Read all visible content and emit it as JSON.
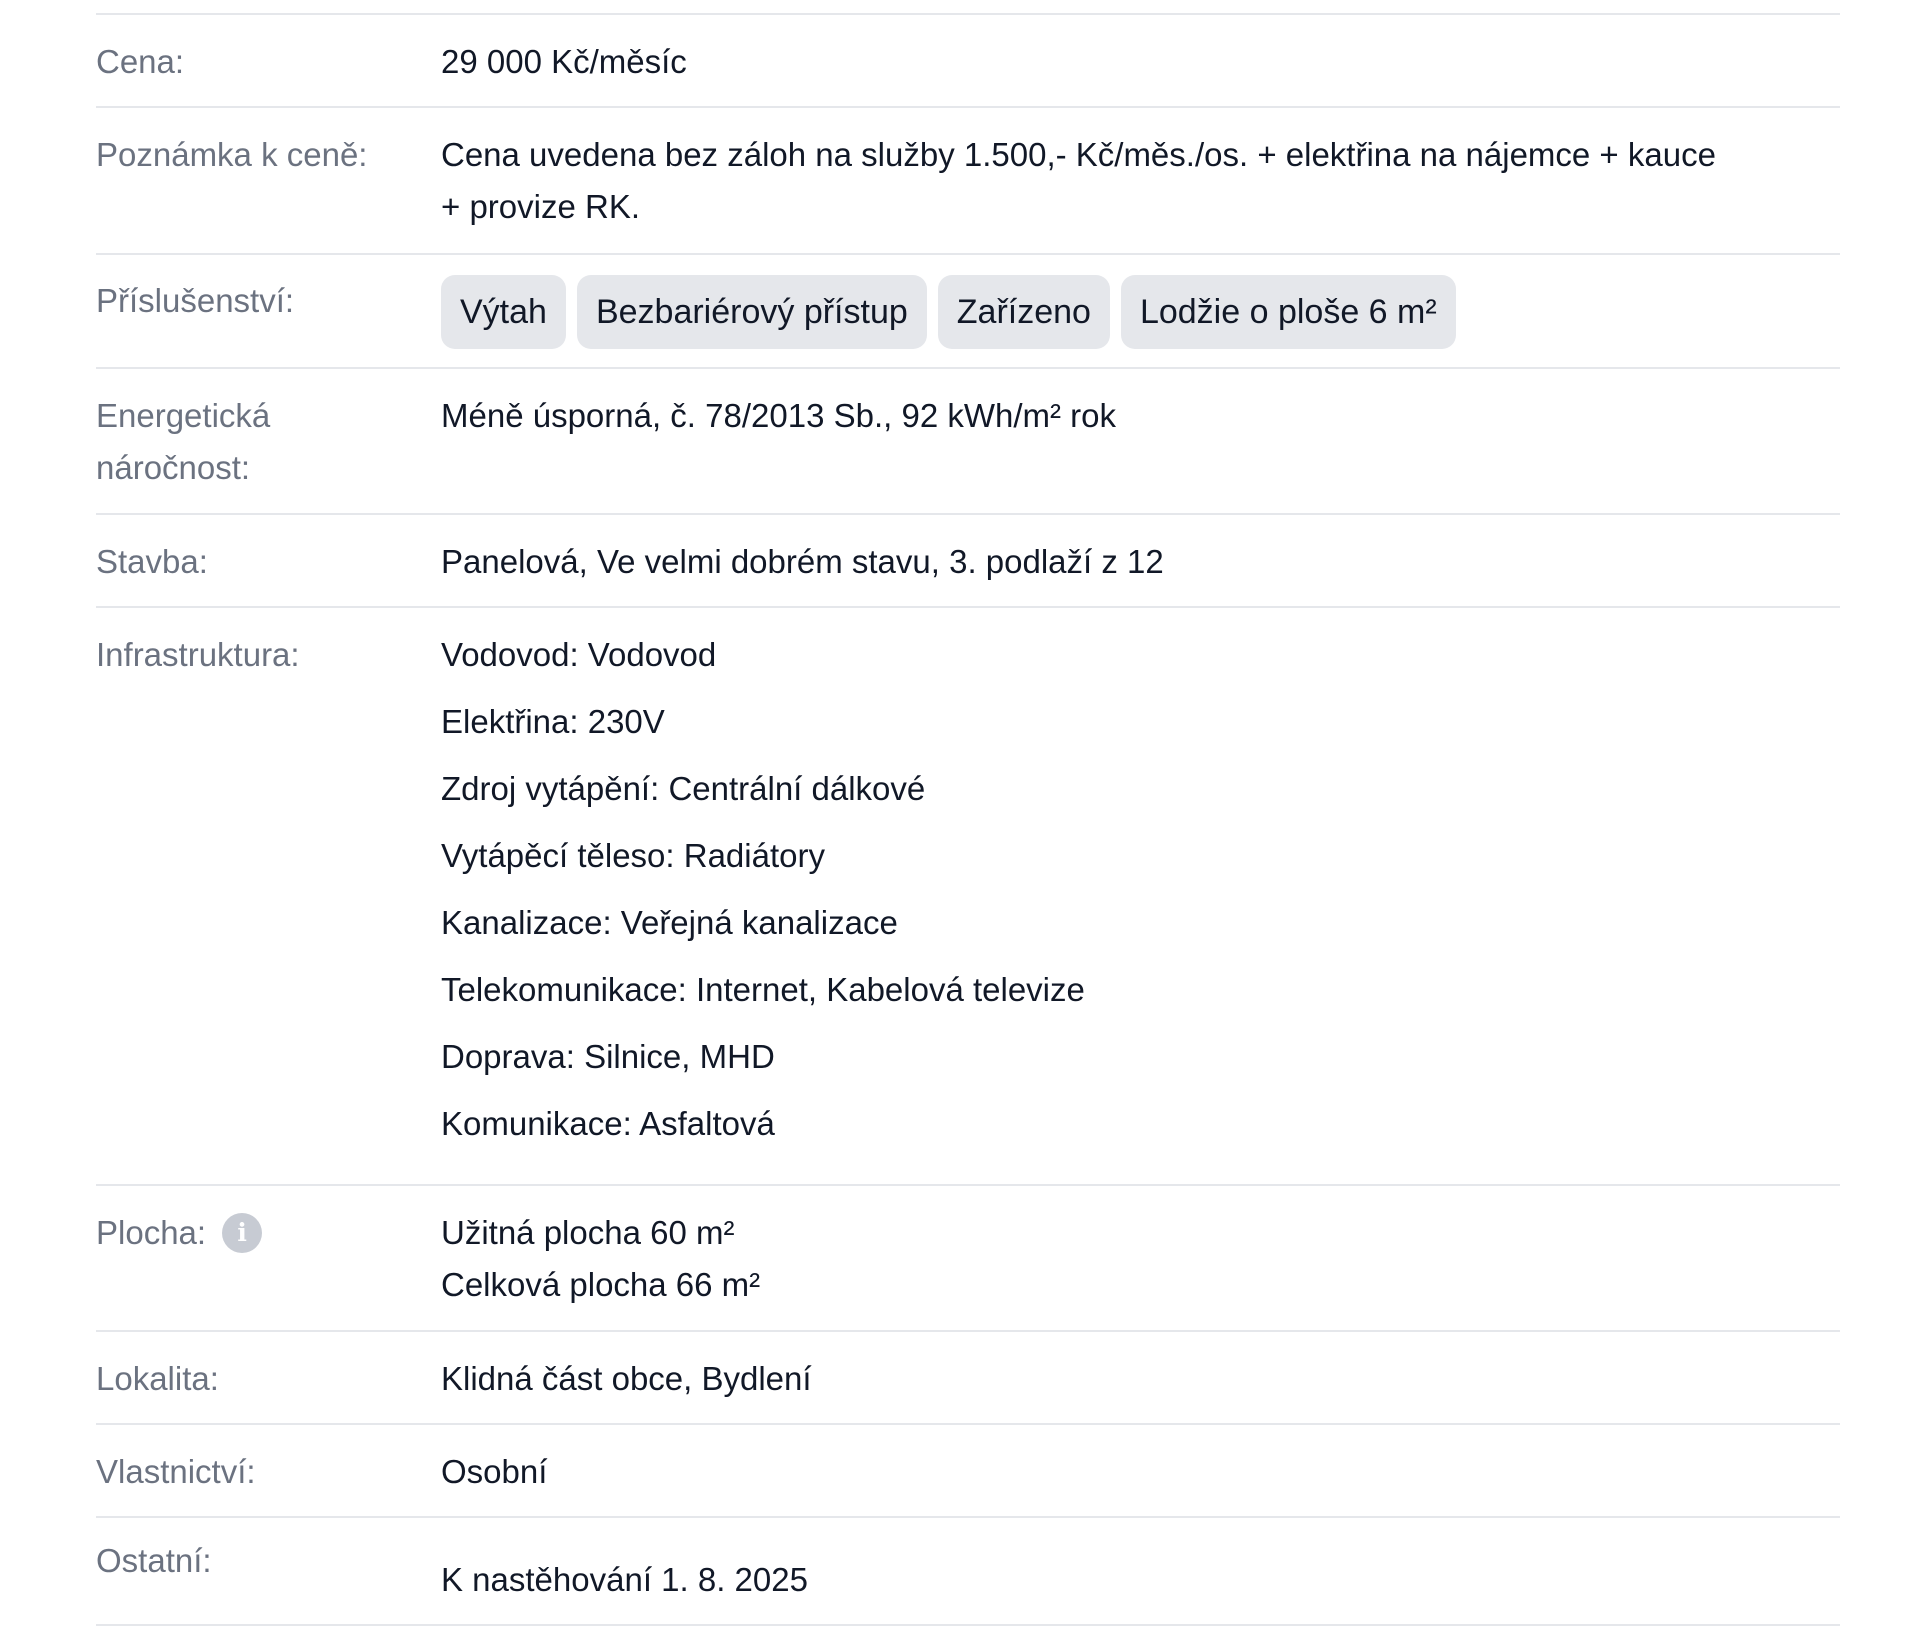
{
  "details": {
    "cena": {
      "label": "Cena:",
      "value": "29 000 Kč/měsíc"
    },
    "poznamka": {
      "label": "Poznámka k ceně:",
      "lines": [
        "Cena uvedena bez záloh na služby 1.500,- Kč/měs./os. + elektřina na nájemce + kauce",
        "+ provize RK."
      ]
    },
    "prislusenstvi": {
      "label": "Příslušenství:",
      "chips": [
        "Výtah",
        "Bezbariérový přístup",
        "Zařízeno",
        "Lodžie o ploše 6 m²"
      ]
    },
    "energeticka": {
      "label_lines": [
        "Energetická",
        "náročnost:"
      ],
      "value": "Méně úsporná, č. 78/2013 Sb., 92 kWh/m² rok"
    },
    "stavba": {
      "label": "Stavba:",
      "value": "Panelová, Ve velmi dobrém stavu, 3. podlaží z 12"
    },
    "infrastruktura": {
      "label": "Infrastruktura:",
      "items": [
        "Vodovod: Vodovod",
        "Elektřina: 230V",
        "Zdroj vytápění: Centrální dálkové",
        "Vytápěcí těleso: Radiátory",
        "Kanalizace: Veřejná kanalizace",
        "Telekomunikace: Internet, Kabelová televize",
        "Doprava: Silnice, MHD",
        "Komunikace: Asfaltová"
      ]
    },
    "plocha": {
      "label": "Plocha:",
      "info_icon": "info-icon",
      "lines": [
        "Užitná plocha 60 m²",
        "Celková plocha 66 m²"
      ]
    },
    "lokalita": {
      "label": "Lokalita:",
      "value": "Klidná část obce, Bydlení"
    },
    "vlastnictvi": {
      "label": "Vlastnictví:",
      "value": "Osobní"
    },
    "ostatni": {
      "label": "Ostatní:",
      "value": "K nastěhování 1. 8. 2025"
    }
  },
  "colors": {
    "label": "#6b7280",
    "value": "#111827",
    "divider": "#e5e7eb",
    "chip_bg": "#e5e7eb",
    "info_icon_bg": "#c7cbd3"
  }
}
